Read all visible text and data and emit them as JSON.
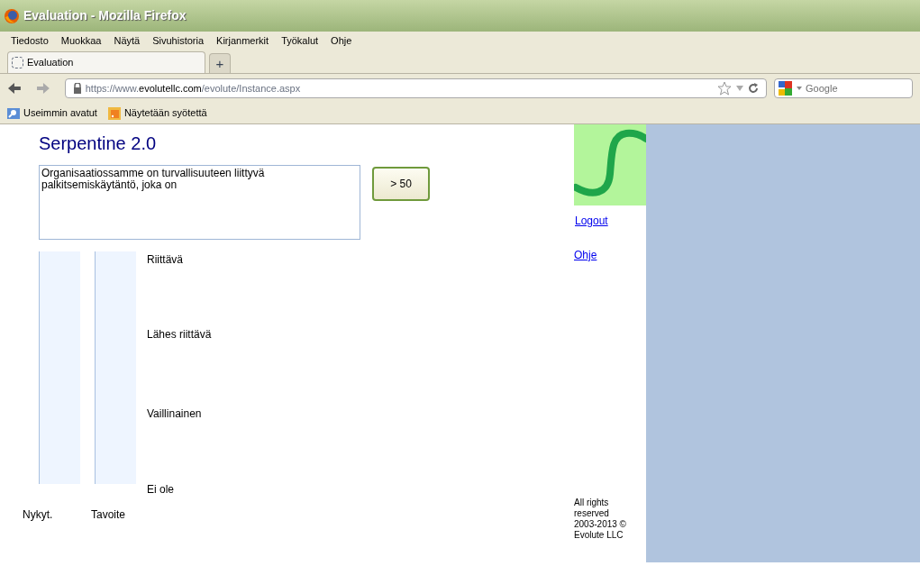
{
  "window": {
    "title": "Evaluation - Mozilla Firefox"
  },
  "menu": [
    "Tiedosto",
    "Muokkaa",
    "Näytä",
    "Sivuhistoria",
    "Kirjanmerkit",
    "Työkalut",
    "Ohje"
  ],
  "tabs": [
    {
      "label": "Evaluation",
      "selected": true
    }
  ],
  "new_tab": "+",
  "address": {
    "url": "https://www.**evolutellc.com**/evolute/Instance.aspx"
  },
  "search": {
    "placeholder": "Google"
  },
  "bookmarks": [
    "Useimmin avatut",
    "Näytetään syötettä"
  ],
  "page": {
    "title": "Serpentine 2.0",
    "question": "Organisaatiossamme on turvallisuuteen liittyvä palkitsemiskäytäntö, joka on",
    "next_button": "> 50",
    "links": [
      "Logout",
      "Ohje"
    ],
    "scale": [
      "Riittävä",
      "Lähes riittävä",
      "Vaillinainen",
      "Ei ole"
    ],
    "columns": [
      "Nykyt.",
      "Tavoite"
    ],
    "footer": "All rights reserved 2003-2013 © Evolute LLC"
  }
}
